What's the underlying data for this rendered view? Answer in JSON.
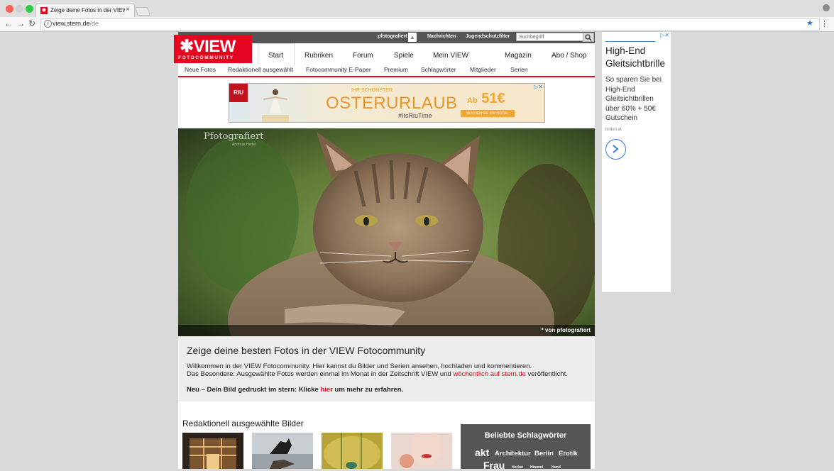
{
  "browser": {
    "tab_title": "Zeige deine Fotos in der VIEW",
    "tab_close": "×",
    "url_host": "view.stern.de",
    "url_path": "/de"
  },
  "topbar": {
    "links": [
      "pfotografiert",
      "Nachrichten",
      "Jugendschutzfilter"
    ],
    "search_placeholder": "Suchbegriff"
  },
  "logo": {
    "main": "VIEW",
    "sub": "FOTOCOMMUNITY"
  },
  "main_nav": [
    "Start",
    "Rubriken",
    "Forum",
    "Spiele",
    "Mein VIEW",
    "Magazin",
    "Abo / Shop"
  ],
  "sub_nav": [
    "Neue Fotos",
    "Redaktionell ausgewählt",
    "Fotocommunity E-Paper",
    "Premium",
    "Schlagwörter",
    "Mitglieder",
    "Serien"
  ],
  "banner_ad": {
    "brand": "RIU",
    "small": "IHR SCHÖNSTER",
    "headline": "OSTERURLAUB",
    "hashtag": "#ItsRiuTime",
    "price_prefix": "Ab",
    "price": "51€",
    "button": "BUCHEN SIE IHR HOTEL"
  },
  "hero": {
    "watermark": "Pfotografiert",
    "watermark_sub": "Andreas Hertel",
    "caption": "* von pfotografiert"
  },
  "intro": {
    "title": "Zeige deine besten Fotos in der VIEW Fotocommunity",
    "p1": "Willkommen in der VIEW Fotocommunity. Hier kannst du Bilder und Serien ansehen, hochladen und kommentieren.",
    "p2_a": "Das Besondere: Ausgewählte Fotos werden einmal im Monat in der Zeitschrift VIEW und ",
    "p2_link": "wöchentlich auf stern.de",
    "p2_b": " veröffentlicht.",
    "p3_a": "Neu – Dein Bild gedruckt im stern: Klicke ",
    "p3_link": "hier",
    "p3_b": " um mehr zu erfahren."
  },
  "selected": {
    "title": "Redaktionell ausgewählte Bilder"
  },
  "tags": {
    "title": "Beliebte Schlagwörter",
    "items": [
      "akt",
      "Architektur",
      "Berlin",
      "Erotik",
      "Frau",
      "Herbst",
      "Himmel",
      "Hund"
    ]
  },
  "side_ad": {
    "headline": "High-End Gleitsichtbrille",
    "body": "So sparen Sie bei High-End Gleitsichtbrillen über 60% + 50€ Gutschein",
    "domain": "brillen.at"
  },
  "colors": {
    "brand_red": "#e40521",
    "topbar": "#555555",
    "link_blue": "#3a78d8"
  }
}
